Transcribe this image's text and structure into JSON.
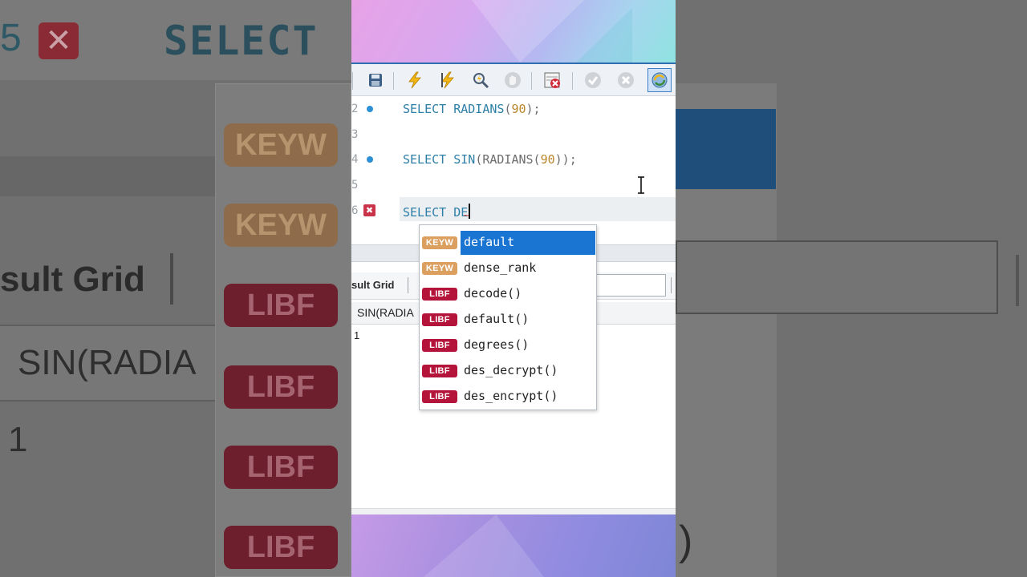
{
  "background": {
    "line_number": "5",
    "select_text": "SELECT",
    "badges": [
      "KEYW",
      "KEYW",
      "LIBF",
      "LIBF",
      "LIBF",
      "LIBF"
    ],
    "result_grid_label": "sult Grid",
    "column_header": "SIN(RADIA",
    "cell_value": "1",
    "right_paren": ")"
  },
  "toolbar": {
    "buttons": [
      "save-icon",
      "execute-icon",
      "execute-current-icon",
      "explain-icon",
      "stop-icon",
      "toggle-error-icon",
      "commit-icon",
      "rollback-icon",
      "autocommit-icon"
    ]
  },
  "editor": {
    "lines": [
      {
        "num": "2",
        "marker": "dot",
        "code_kw": "SELECT RADIANS",
        "code_open": "(",
        "code_num": "90",
        "code_close": ");"
      },
      {
        "num": "3",
        "marker": "",
        "code_kw": "",
        "code_open": "",
        "code_num": "",
        "code_close": ""
      },
      {
        "num": "4",
        "marker": "dot",
        "code_kw": "SELECT SIN",
        "code_open": "(RADIANS(",
        "code_num": "90",
        "code_close": "));"
      },
      {
        "num": "5",
        "marker": "",
        "code_kw": "",
        "code_open": "",
        "code_num": "",
        "code_close": ""
      },
      {
        "num": "6",
        "marker": "error",
        "code_kw": "SELECT DE",
        "code_open": "",
        "code_num": "",
        "code_close": ""
      }
    ],
    "error_marker": "✖"
  },
  "results": {
    "tab_label": "sult Grid",
    "column_header": "SIN(RADIA",
    "cell_value": "1"
  },
  "autocomplete": {
    "items": [
      {
        "badge": "KEYW",
        "label": "default",
        "selected": true
      },
      {
        "badge": "KEYW",
        "label": "dense_rank",
        "selected": false
      },
      {
        "badge": "LIBF",
        "label": "decode()",
        "selected": false
      },
      {
        "badge": "LIBF",
        "label": "default()",
        "selected": false
      },
      {
        "badge": "LIBF",
        "label": "degrees()",
        "selected": false
      },
      {
        "badge": "LIBF",
        "label": "des_decrypt()",
        "selected": false
      },
      {
        "badge": "LIBF",
        "label": "des_encrypt()",
        "selected": false
      }
    ]
  },
  "colors": {
    "keyword": "#2e7fa7",
    "number": "#b9862b",
    "selection": "#1a74d2",
    "keyw_badge": "#dba05f",
    "libf_badge": "#b5143a",
    "error": "#c9344b"
  }
}
